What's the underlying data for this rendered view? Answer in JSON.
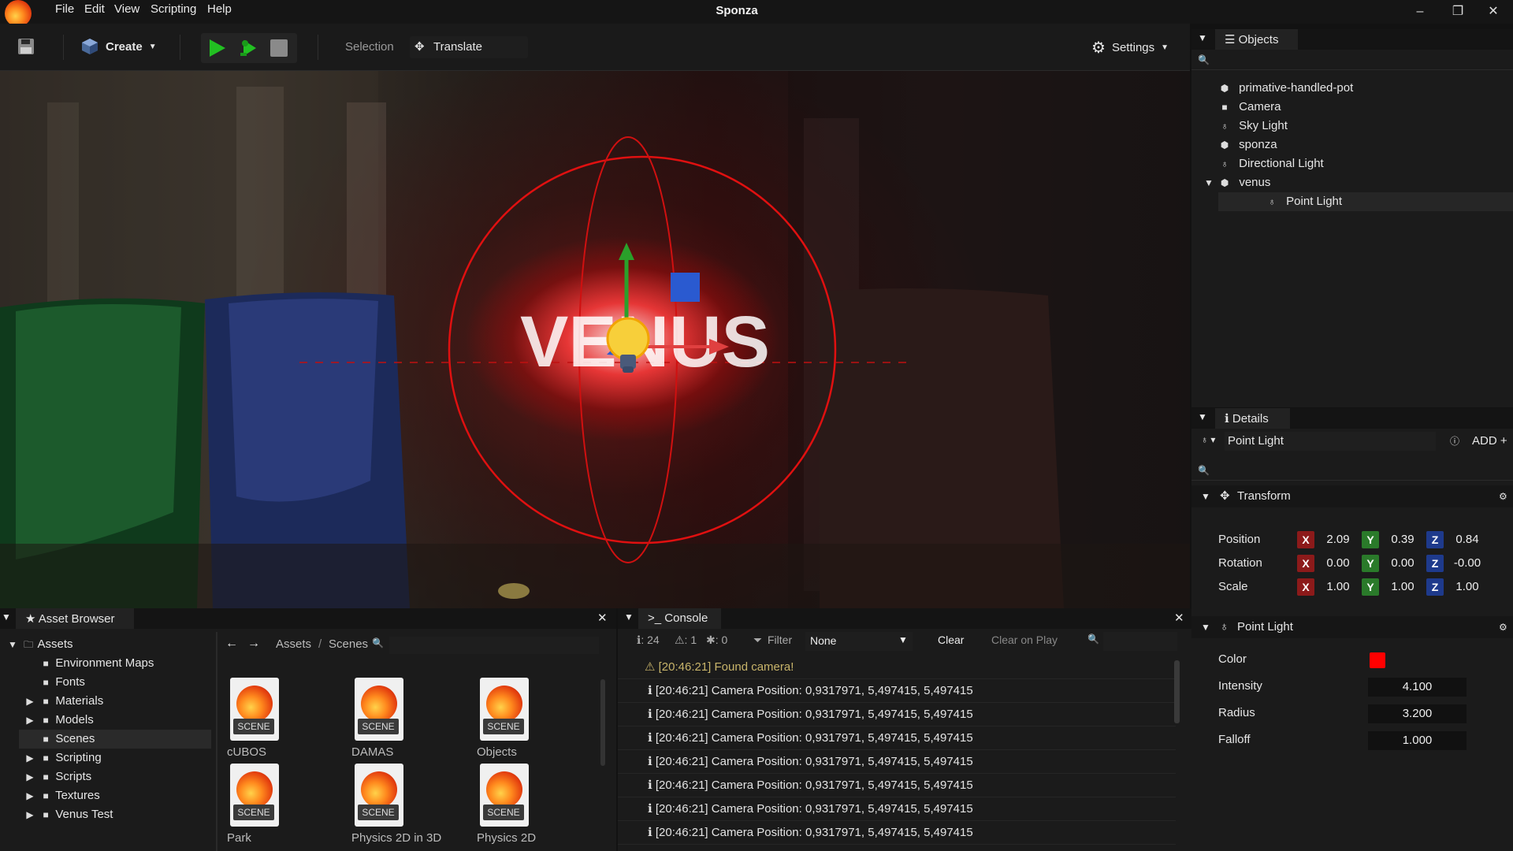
{
  "app": {
    "title": "Sponza",
    "menu": [
      "File",
      "Edit",
      "View",
      "Scripting",
      "Help"
    ]
  },
  "toolbar": {
    "create_label": "Create",
    "selection_label": "Selection",
    "translate_label": "Translate",
    "settings_label": "Settings"
  },
  "viewport": {
    "overlay_text": "VENUS"
  },
  "objects": {
    "tab": "Objects",
    "items": [
      {
        "label": "primative-handled-pot",
        "icon": "mesh-icon"
      },
      {
        "label": "Camera",
        "icon": "camera-icon"
      },
      {
        "label": "Sky Light",
        "icon": "light-icon"
      },
      {
        "label": "sponza",
        "icon": "mesh-icon"
      },
      {
        "label": "Directional Light",
        "icon": "light-icon"
      },
      {
        "label": "venus",
        "icon": "mesh-icon",
        "expanded": true
      },
      {
        "label": "Point Light",
        "icon": "light-icon",
        "selected": true
      }
    ]
  },
  "details": {
    "tab": "Details",
    "object_name": "Point Light",
    "add_label": "ADD",
    "transform": {
      "title": "Transform",
      "position": {
        "label": "Position",
        "x": "2.09",
        "y": "0.39",
        "z": "0.84"
      },
      "rotation": {
        "label": "Rotation",
        "x": "0.00",
        "y": "0.00",
        "z": "-0.00"
      },
      "scale": {
        "label": "Scale",
        "x": "1.00",
        "y": "1.00",
        "z": "1.00"
      }
    },
    "point_light": {
      "title": "Point Light",
      "color_label": "Color",
      "color_value": "#ff0000",
      "intensity_label": "Intensity",
      "intensity": "4.100",
      "radius_label": "Radius",
      "radius": "3.200",
      "falloff_label": "Falloff",
      "falloff": "1.000"
    }
  },
  "asset_browser": {
    "tab": "Asset Browser",
    "tree": [
      {
        "label": "Assets",
        "level": 0,
        "arrow": "▼"
      },
      {
        "label": "Environment Maps",
        "level": 1,
        "arrow": ""
      },
      {
        "label": "Fonts",
        "level": 1,
        "arrow": ""
      },
      {
        "label": "Materials",
        "level": 1,
        "arrow": "▶"
      },
      {
        "label": "Models",
        "level": 1,
        "arrow": "▶"
      },
      {
        "label": "Scenes",
        "level": 1,
        "arrow": "",
        "selected": true
      },
      {
        "label": "Scripting",
        "level": 1,
        "arrow": "▶"
      },
      {
        "label": "Scripts",
        "level": 1,
        "arrow": "▶"
      },
      {
        "label": "Textures",
        "level": 1,
        "arrow": "▶"
      },
      {
        "label": "Venus Test",
        "level": 1,
        "arrow": "▶"
      }
    ],
    "breadcrumb": [
      "Assets",
      "Scenes"
    ],
    "breadcrumb_sep": "/",
    "badge": "SCENE",
    "files": [
      "cUBOS",
      "DAMAS",
      "Objects",
      "Park",
      "Physics 2D in 3D",
      "Physics 2D"
    ]
  },
  "console": {
    "tab": "Console",
    "info_count": "24",
    "warn_count": "1",
    "error_count": "0",
    "filter_label": "Filter",
    "filter_value": "None",
    "clear_label": "Clear",
    "clear_on_play_label": "Clear on Play",
    "messages": [
      {
        "type": "warning",
        "text": "[20:46:21] Found camera!"
      },
      {
        "type": "info",
        "text": "[20:46:21] Camera Position: 0,9317971, 5,497415, 5,497415"
      },
      {
        "type": "info",
        "text": "[20:46:21] Camera Position: 0,9317971, 5,497415, 5,497415"
      },
      {
        "type": "info",
        "text": "[20:46:21] Camera Position: 0,9317971, 5,497415, 5,497415"
      },
      {
        "type": "info",
        "text": "[20:46:21] Camera Position: 0,9317971, 5,497415, 5,497415"
      },
      {
        "type": "info",
        "text": "[20:46:21] Camera Position: 0,9317971, 5,497415, 5,497415"
      },
      {
        "type": "info",
        "text": "[20:46:21] Camera Position: 0,9317971, 5,497415, 5,497415"
      },
      {
        "type": "info",
        "text": "[20:46:21] Camera Position: 0,9317971, 5,497415, 5,497415"
      }
    ]
  },
  "colors": {
    "play": "#22c022",
    "warning": "#c8b46a",
    "gizmo_ring": "#e01010",
    "axis_x": "#e04040",
    "axis_y": "#2aa02a",
    "axis_z": "#2a5ad0"
  }
}
